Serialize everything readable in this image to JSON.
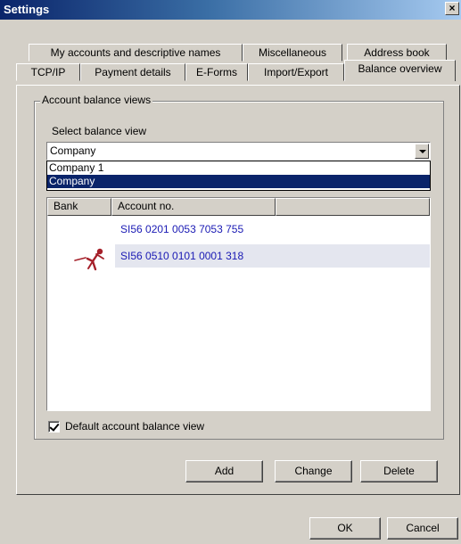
{
  "window": {
    "title": "Settings",
    "close_glyph": "×"
  },
  "tabs": {
    "row1": [
      "My accounts and descriptive names",
      "Miscellaneous",
      "Address book"
    ],
    "row2": [
      "TCP/IP",
      "Payment details",
      "E-Forms",
      "Import/Export",
      "Balance overview"
    ],
    "active": "Balance overview"
  },
  "group": {
    "legend": "Account balance views",
    "select_label": "Select balance view",
    "selected_view": "Company",
    "dropdown_options": [
      "Company 1",
      "Company"
    ],
    "dropdown_selected_index": 1
  },
  "list": {
    "columns": [
      "Bank",
      "Account no."
    ],
    "rows": [
      {
        "bank_icon": "bank-logo-icon",
        "account": "SI56 0201 0053 7053 755"
      },
      {
        "bank_icon": "bank-logo-icon",
        "account": "SI56 0510 0101 0001 318"
      }
    ]
  },
  "default_view": {
    "label": "Default account balance view",
    "checked": true
  },
  "buttons": {
    "add": "Add",
    "change": "Change",
    "delete": "Delete",
    "ok": "OK",
    "cancel": "Cancel"
  },
  "colors": {
    "title_bar": "#0a246a",
    "selection": "#0a246a",
    "account_text": "#1a1ab4",
    "bank_logo": "#a5202a"
  }
}
